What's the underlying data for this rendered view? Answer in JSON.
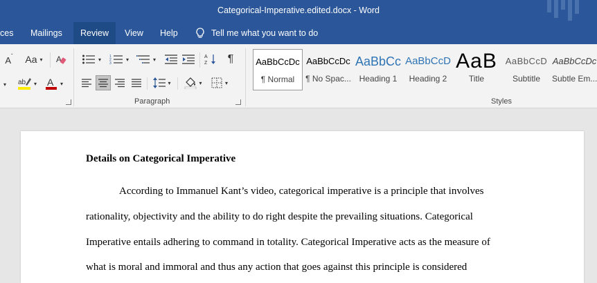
{
  "window": {
    "title": "Categorical-Imperative.edited.docx  -  Word"
  },
  "menu": {
    "tabs": [
      "ces",
      "Mailings",
      "Review",
      "View",
      "Help"
    ],
    "active": "Review",
    "tell_me": "Tell me what you want to do"
  },
  "ribbon": {
    "font_group": {
      "aa_label": "Aa",
      "size_label": "A"
    },
    "paragraph_group": {
      "label": "Paragraph",
      "pilcrow": "¶"
    },
    "styles_group": {
      "label": "Styles",
      "items": [
        {
          "sample": "AaBbCcDc",
          "name": "¶ Normal"
        },
        {
          "sample": "AaBbCcDc",
          "name": "¶ No Spac..."
        },
        {
          "sample": "AaBbCc",
          "name": "Heading 1"
        },
        {
          "sample": "AaBbCcD",
          "name": "Heading 2"
        },
        {
          "sample": "AaB",
          "name": "Title"
        },
        {
          "sample": "AaBbCcD",
          "name": "Subtitle"
        },
        {
          "sample": "AaBbCcDc",
          "name": "Subtle Em..."
        }
      ]
    }
  },
  "document": {
    "heading": "Details on Categorical Imperative",
    "lines": [
      "According to Immanuel Kant’s video, categorical imperative is a principle that involves",
      "rationality, objectivity and the ability to do right despite the prevailing situations. Categorical",
      "Imperative entails adhering to command in totality. Categorical Imperative acts as the measure of",
      "what is moral and immoral and thus any action that goes against this principle is considered"
    ]
  },
  "colors": {
    "word_blue": "#2b579a",
    "active_tab": "#1e4a85",
    "highlight_yellow": "#ffeb00",
    "font_red": "#c00000",
    "heading_blue": "#2e74b5"
  }
}
